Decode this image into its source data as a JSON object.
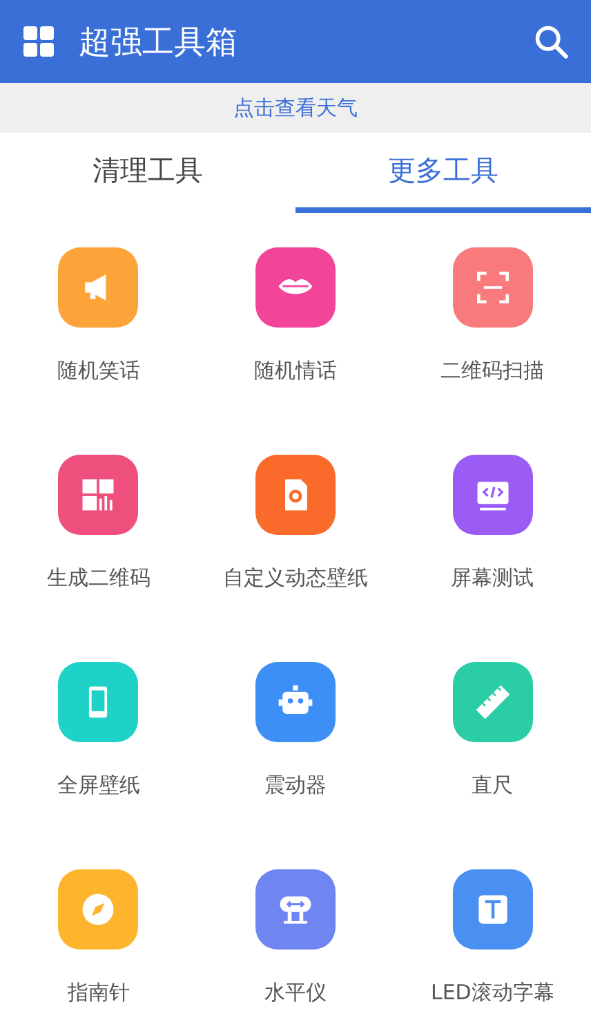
{
  "header": {
    "title": "超强工具箱"
  },
  "weather_link": "点击查看天气",
  "tabs": [
    {
      "label": "清理工具",
      "selected": false
    },
    {
      "label": "更多工具",
      "selected": true
    }
  ],
  "tools": [
    {
      "label": "随机笑话",
      "kind": "megaphone",
      "color": "#fca43a"
    },
    {
      "label": "随机情话",
      "kind": "lips",
      "color": "#f2459a"
    },
    {
      "label": "二维码扫描",
      "kind": "scan",
      "color": "#f87a7c"
    },
    {
      "label": "生成二维码",
      "kind": "qrcode",
      "color": "#ee4f7c"
    },
    {
      "label": "自定义动态壁纸",
      "kind": "wallpaper",
      "color": "#fa6a2a"
    },
    {
      "label": "屏幕测试",
      "kind": "code",
      "color": "#9a5cf5"
    },
    {
      "label": "全屏壁纸",
      "kind": "phone",
      "color": "#1ed2c8"
    },
    {
      "label": "震动器",
      "kind": "robot",
      "color": "#3d8ef5"
    },
    {
      "label": "直尺",
      "kind": "ruler",
      "color": "#2bcda6"
    },
    {
      "label": "指南针",
      "kind": "compass",
      "color": "#fcb52c"
    },
    {
      "label": "水平仪",
      "kind": "level",
      "color": "#6f86f2"
    },
    {
      "label": "LED滚动字幕",
      "kind": "text",
      "color": "#4a90f2"
    }
  ]
}
